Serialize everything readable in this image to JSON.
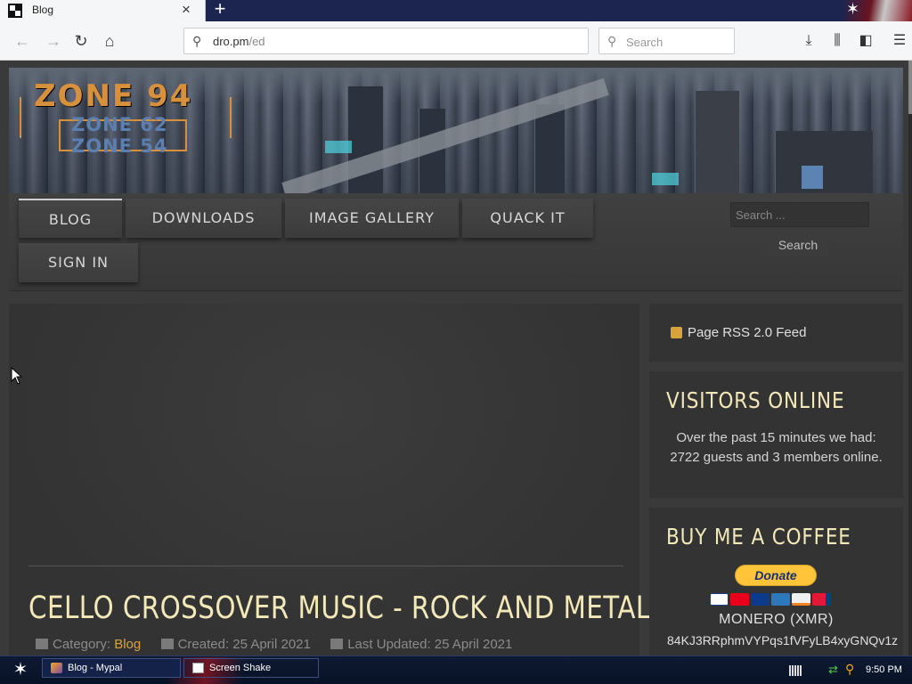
{
  "browser": {
    "tab_title": "Blog",
    "tab_close": "×",
    "new_tab": "+",
    "url_host": "dro.pm",
    "url_path": "/ed",
    "search_placeholder": "Search"
  },
  "site": {
    "logo_main": "ZONE 94",
    "logo_sub_1": "ZONE 62",
    "logo_sub_2": "ZONE 54",
    "menu": [
      "BLOG",
      "DOWNLOADS",
      "IMAGE GALLERY",
      "QUACK IT",
      "SIGN IN"
    ],
    "search_placeholder": "Search ...",
    "search_button": "Search"
  },
  "article": {
    "title": "CELLO CROSSOVER MUSIC - ROCK AND METAL",
    "category_label": "Category:",
    "category_value": "Blog",
    "created": "Created: 25 April 2021",
    "updated": "Last Updated: 25 April 2021"
  },
  "sidebar": {
    "rss": "Page RSS 2.0 Feed",
    "visitors_title": "VISITORS ONLINE",
    "visitors_text": "Over the past 15 minutes we had: 2722 guests and 3 members online.",
    "coffee_title": "BUY ME A COFFEE",
    "donate_label": "Donate",
    "monero_title": "MONERO (XMR)",
    "monero_address": "84KJ3RRphmVYPqs1fVFyLB4xyGNQv1z"
  },
  "taskbar": {
    "tasks": [
      "Blog - Mypal",
      "Screen Shake"
    ],
    "clock": "9:50 PM"
  },
  "colors": {
    "accent_gold": "#d7a43c",
    "heading_cream": "#f2e8b8",
    "paypal_yellow": "#ffc439"
  }
}
